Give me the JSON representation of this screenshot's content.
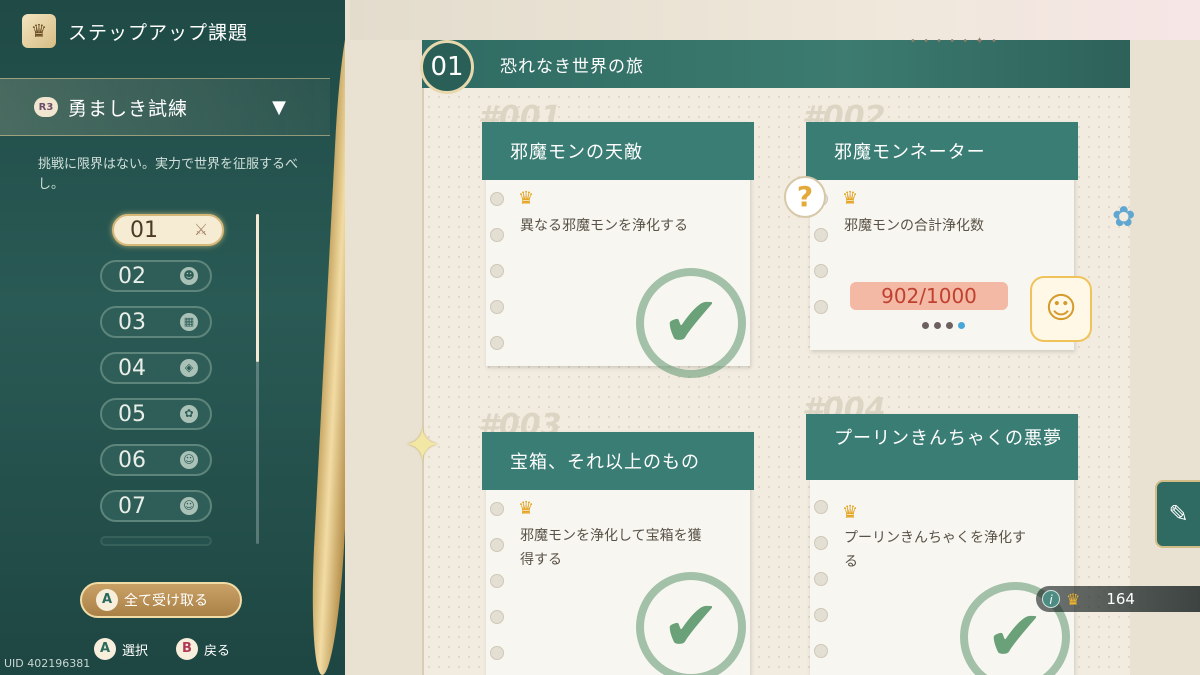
{
  "panel": {
    "title": "ステップアップ課題",
    "category_badge": "R3",
    "category": "勇ましき試練",
    "description": "挑戦に限界はない。実力で世界を征服するべし。",
    "levels": [
      "01",
      "02",
      "03",
      "04",
      "05",
      "06",
      "07"
    ],
    "active_level": "01",
    "claim_all_button": "A",
    "claim_all_label": "全て受け取る",
    "hint_select_key": "A",
    "hint_select": "選択",
    "hint_back_key": "B",
    "hint_back": "戻る",
    "uid": "UID 402196381"
  },
  "chapter": {
    "number": "01",
    "title": "恐れなき世界の旅"
  },
  "cards": [
    {
      "id": "#001",
      "title": "邪魔モンの天敵",
      "desc": "異なる邪魔モンを浄化する",
      "status": "completed"
    },
    {
      "id": "#002",
      "title": "邪魔モンネーター",
      "desc": "邪魔モンの合計浄化数",
      "progress": "902/1000",
      "progress_value": 902,
      "progress_max": 1000,
      "status": "in-progress"
    },
    {
      "id": "#003",
      "title": "宝箱、それ以上のもの",
      "desc": "邪魔モンを浄化して宝箱を獲得する",
      "status": "completed"
    },
    {
      "id": "#004",
      "title": "プーリンきんちゃくの悪夢",
      "desc": "プーリンきんちゃくを浄化する",
      "status": "completed"
    }
  ],
  "crown_total": "164",
  "icons": {
    "check": "check-stamp-icon",
    "crown": "crown-icon",
    "edit": "edit-icon",
    "info": "info-icon"
  }
}
